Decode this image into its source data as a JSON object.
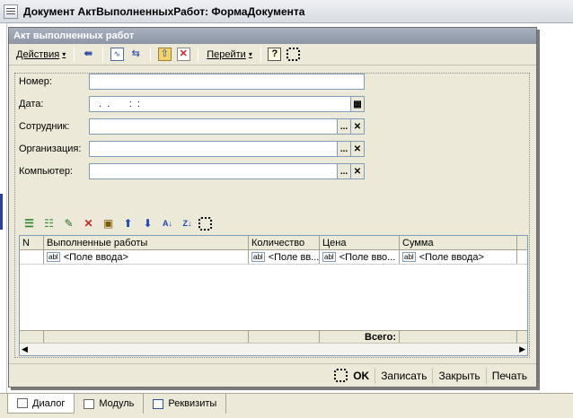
{
  "window": {
    "title": "Документ АктВыполненныхРабот: ФормаДокумента"
  },
  "form": {
    "caption": "Акт выполненных работ",
    "toolbar": {
      "actions_label": "Действия",
      "goto_label": "Перейти",
      "help_label": "?"
    },
    "fields": {
      "number": {
        "label": "Номер:",
        "value": ""
      },
      "date": {
        "label": "Дата:",
        "value": "  .  .       :  :"
      },
      "employee": {
        "label": "Сотрудник:",
        "value": ""
      },
      "organization": {
        "label": "Организация:",
        "value": ""
      },
      "computer": {
        "label": "Компьютер:",
        "value": ""
      }
    },
    "grid": {
      "columns": [
        "N",
        "Выполненные работы",
        "Количество",
        "Цена",
        "Сумма"
      ],
      "row": [
        "",
        "<Поле ввода>",
        "<Поле вв...",
        "<Поле вво...",
        "<Поле ввода>"
      ],
      "field_tag": "abl",
      "total_label": "Всего:"
    },
    "footer": {
      "ok": "OK",
      "write": "Записать",
      "close": "Закрыть",
      "print": "Печать"
    }
  },
  "tabs": [
    {
      "label": "Диалог",
      "active": true
    },
    {
      "label": "Модуль",
      "active": false
    },
    {
      "label": "Реквизиты",
      "active": false
    }
  ],
  "colors": {
    "accent": "#2b3fa0",
    "form_bg": "#ece9d8",
    "caption": "#8d96a6"
  },
  "icons": {
    "dropdown": "▾",
    "up_arrow": "⬆",
    "down_arrow": "⬇",
    "calendar": "▦",
    "ellipsis": "...",
    "clear": "✕"
  }
}
